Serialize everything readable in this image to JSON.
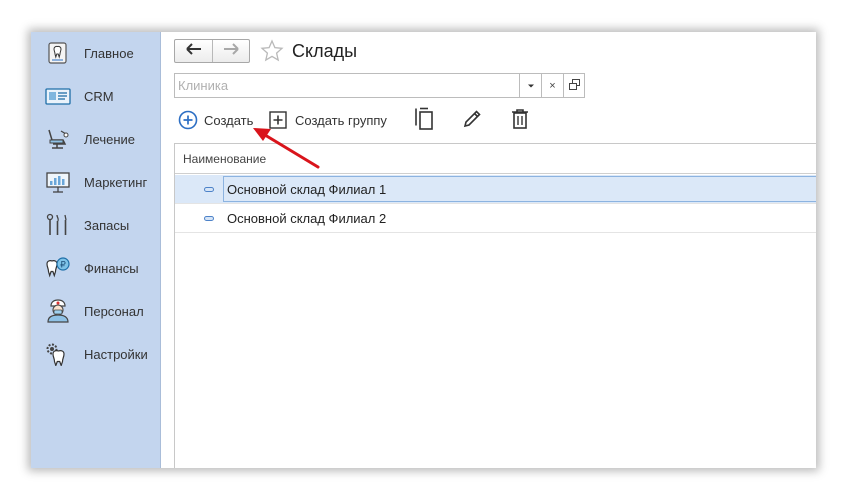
{
  "sidebar": {
    "items": [
      {
        "label": "Главное",
        "icon": "tooth-badge-icon"
      },
      {
        "label": "CRM",
        "icon": "id-card-icon"
      },
      {
        "label": "Лечение",
        "icon": "dental-chair-icon"
      },
      {
        "label": "Маркетинг",
        "icon": "presentation-board-icon"
      },
      {
        "label": "Запасы",
        "icon": "dental-tools-icon"
      },
      {
        "label": "Финансы",
        "icon": "tooth-ruble-icon"
      },
      {
        "label": "Персонал",
        "icon": "doctor-icon"
      },
      {
        "label": "Настройки",
        "icon": "tooth-gear-icon"
      }
    ]
  },
  "header": {
    "title": "Склады",
    "back_icon": "arrow-left-icon",
    "forward_icon": "arrow-right-icon",
    "favorite_icon": "star-outline-icon"
  },
  "filter": {
    "placeholder": "Клиника",
    "clear_glyph": "×"
  },
  "toolbar": {
    "create_label": "Создать",
    "create_group_label": "Создать группу"
  },
  "table": {
    "columns": [
      "Наименование"
    ],
    "rows": [
      {
        "name": "Основной склад Филиал 1",
        "selected": true
      },
      {
        "name": "Основной склад Филиал 2",
        "selected": false
      }
    ]
  },
  "colors": {
    "sidebar_bg": "#c3d5ee",
    "selection_bg": "#dbe8f8",
    "accent_blue": "#2d6fc4",
    "annotation_arrow": "#d9141b"
  }
}
